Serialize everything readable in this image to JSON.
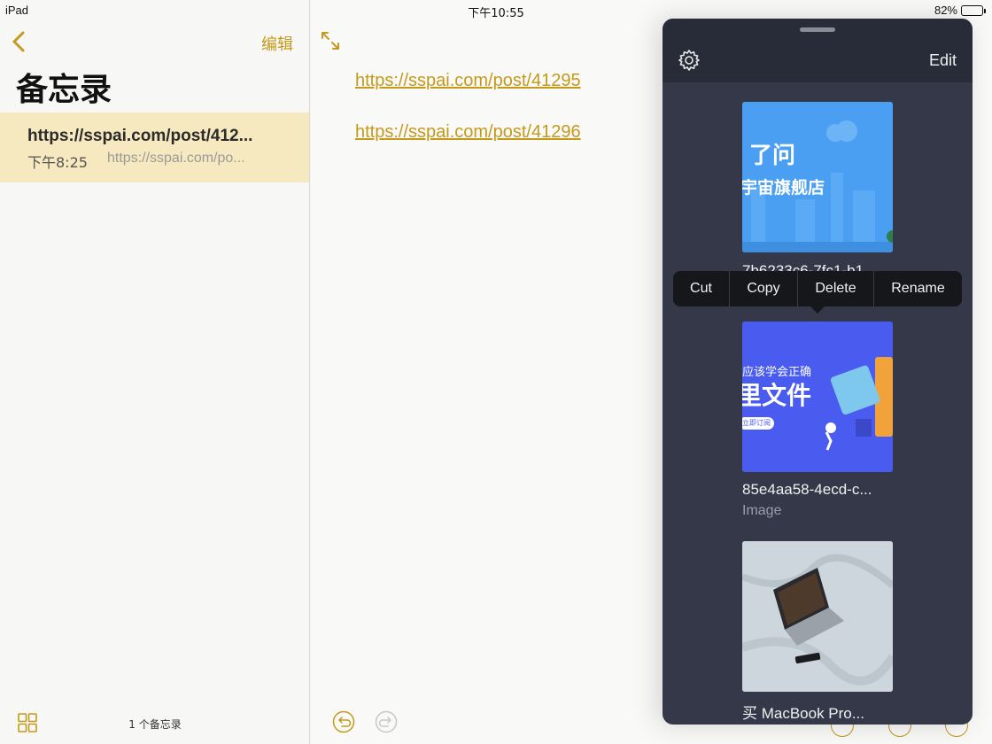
{
  "status_bar": {
    "device": "iPad",
    "time": "下午10:55",
    "battery_percent": "82%",
    "battery_level": 0.82
  },
  "sidebar": {
    "edit_label": "编辑",
    "title": "备忘录",
    "notes": [
      {
        "title": "https://sspai.com/post/412...",
        "time": "下午8:25",
        "preview": "https://sspai.com/po..."
      }
    ],
    "footer_count": "1 个备忘录"
  },
  "note": {
    "links": [
      "https://sspai.com/post/41295",
      "https://sspai.com/post/41296"
    ]
  },
  "panel": {
    "edit_label": "Edit",
    "files": [
      {
        "name": "7b6233c6-7fc1-b1...",
        "type": "",
        "thumb_text_1": "了问",
        "thumb_text_2": "宇宙旗舰店"
      },
      {
        "name": "85e4aa58-4ecd-c...",
        "type": "Image",
        "thumb_text_1": "应该学会正确",
        "thumb_text_2": "里文件",
        "thumb_text_3": "立即订阅"
      },
      {
        "name": "买 MacBook Pro...",
        "type": ""
      }
    ]
  },
  "context_menu": {
    "items": [
      "Cut",
      "Copy",
      "Delete",
      "Rename"
    ]
  },
  "colors": {
    "accent": "#c49a1c",
    "panel_bg": "#343848",
    "note_highlight": "#f6e8bf"
  }
}
